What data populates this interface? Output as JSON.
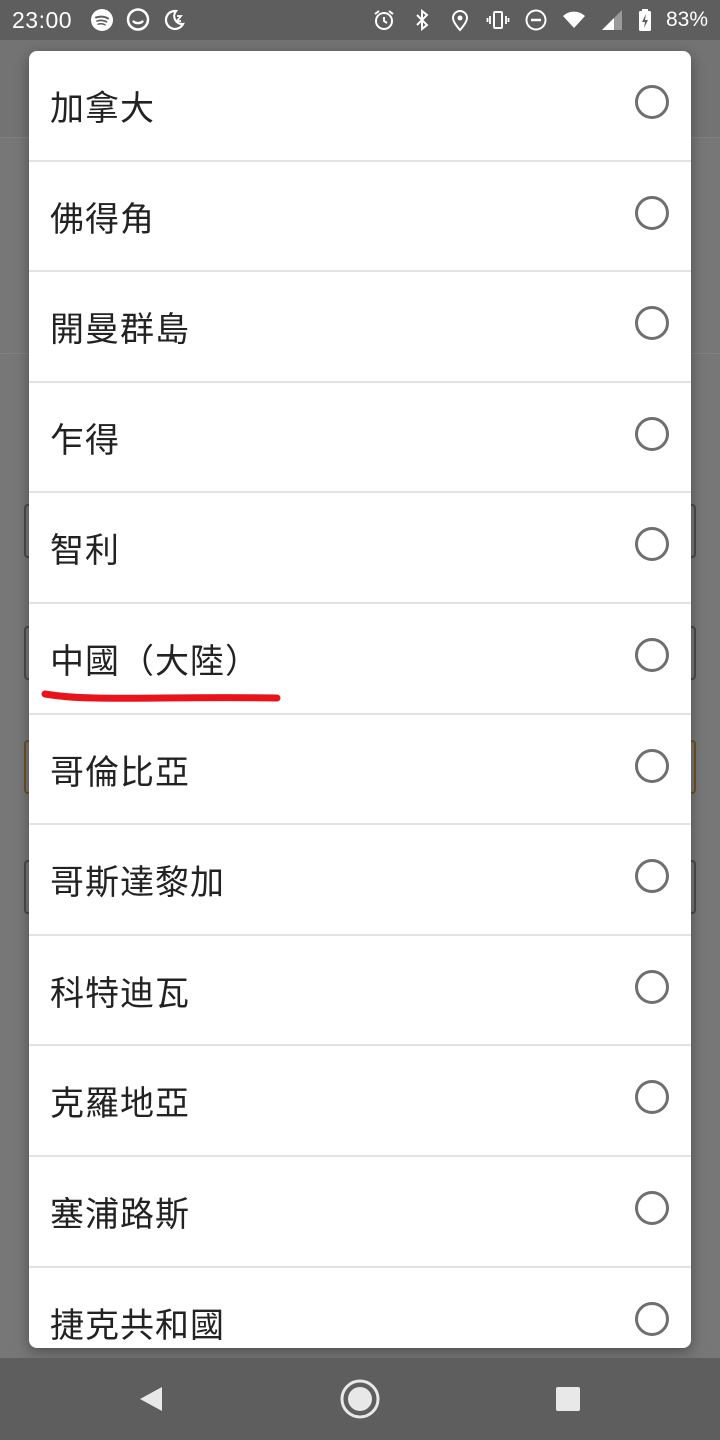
{
  "status_bar": {
    "time": "23:00",
    "left_icons": [
      "spotify-icon",
      "messenger-icon",
      "sleep-mode-icon"
    ],
    "right_icons": [
      "alarm-icon",
      "bluetooth-icon",
      "location-icon",
      "vibrate-icon",
      "do-not-disturb-icon",
      "wifi-icon",
      "cell-signal-icon",
      "battery-charging-icon"
    ],
    "battery_percent": "83%"
  },
  "dialog": {
    "options": [
      {
        "label": "加拿大",
        "selected": false
      },
      {
        "label": "佛得角",
        "selected": false
      },
      {
        "label": "開曼群島",
        "selected": false
      },
      {
        "label": "乍得",
        "selected": false
      },
      {
        "label": "智利",
        "selected": false
      },
      {
        "label": "中國（大陸）",
        "selected": false,
        "annotated_underline": true
      },
      {
        "label": "哥倫比亞",
        "selected": false
      },
      {
        "label": "哥斯達黎加",
        "selected": false
      },
      {
        "label": "科特迪瓦",
        "selected": false
      },
      {
        "label": "克羅地亞",
        "selected": false
      },
      {
        "label": "塞浦路斯",
        "selected": false
      },
      {
        "label": "捷克共和國",
        "selected": false
      }
    ]
  },
  "colors": {
    "annotation_red": "#e8141b",
    "radio_border": "#6f6f6f",
    "scrim": "#6b6b6b"
  },
  "nav_bar": {
    "buttons": [
      "back-icon",
      "home-icon",
      "recents-icon"
    ]
  }
}
